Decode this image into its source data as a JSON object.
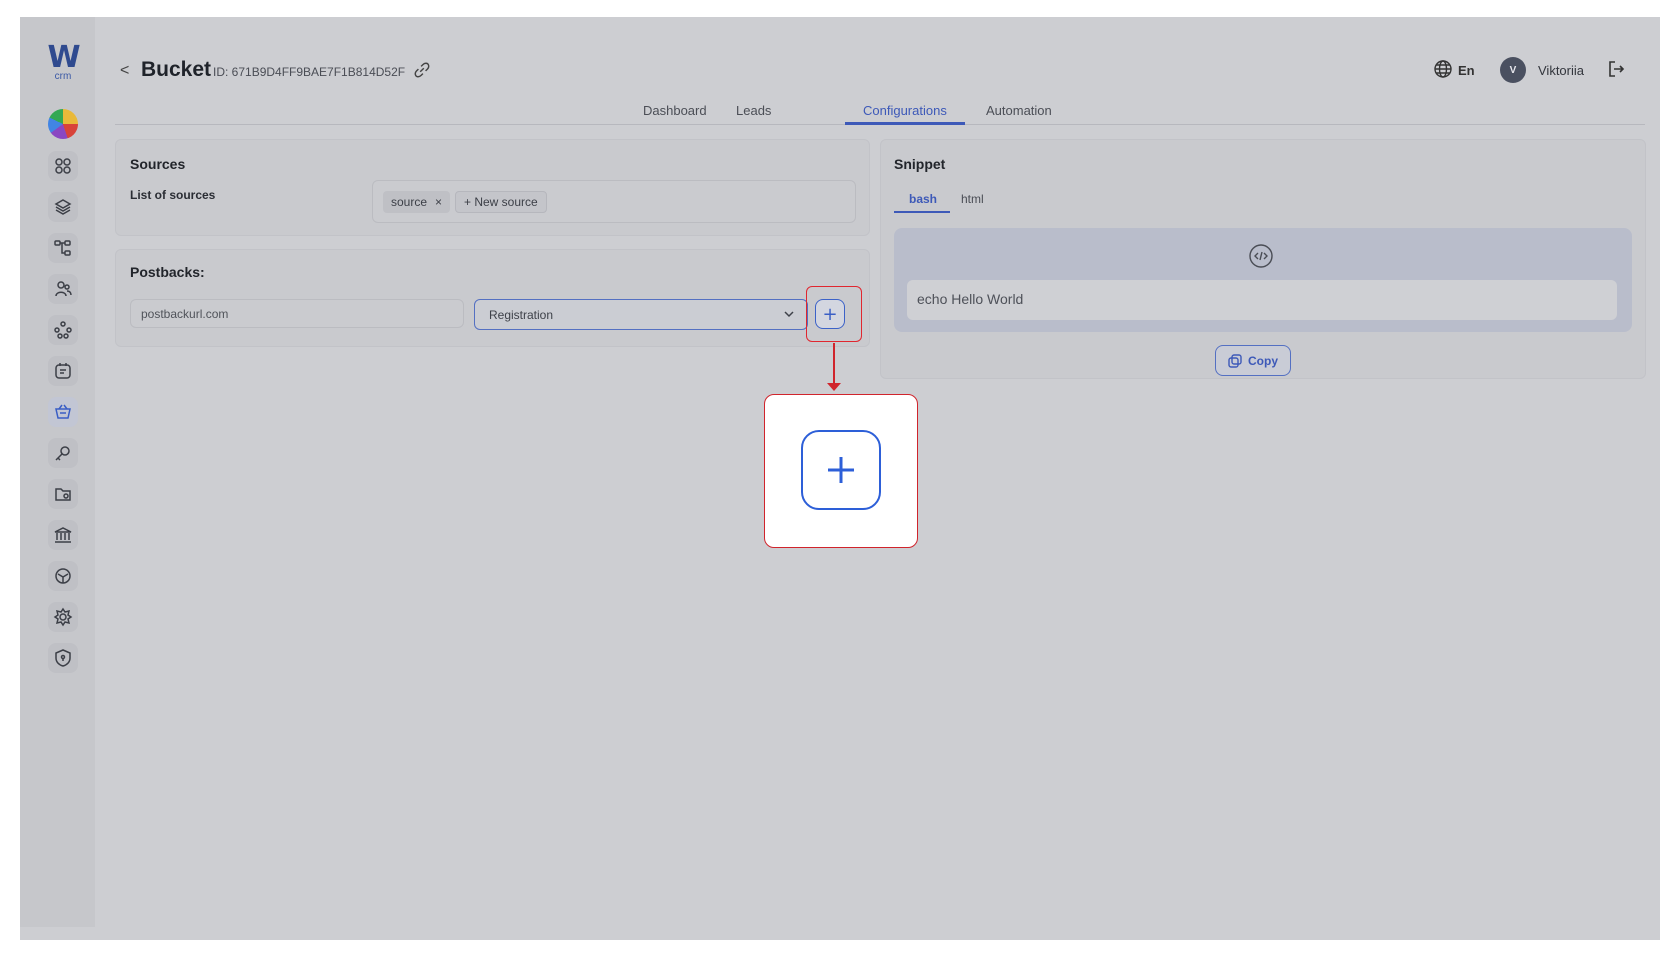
{
  "brand": {
    "logo_letter": "W",
    "logo_sub": "crm"
  },
  "header": {
    "back_glyph": "<",
    "title": "Bucket",
    "bucket_id": "ID: 671B9D4FF9BAE7F1B814D52F",
    "language": "En",
    "avatar_initial": "V",
    "username": "Viktoriia"
  },
  "tabs": [
    {
      "label": "Dashboard",
      "active": false
    },
    {
      "label": "Leads",
      "active": false
    },
    {
      "label": "Configurations",
      "active": true
    },
    {
      "label": "Automation",
      "active": false
    }
  ],
  "sidebar": {
    "items": [
      {
        "icon": "grid-icon"
      },
      {
        "icon": "layers-icon"
      },
      {
        "icon": "hierarchy-icon"
      },
      {
        "icon": "users-icon"
      },
      {
        "icon": "network-icon"
      },
      {
        "icon": "notes-icon"
      },
      {
        "icon": "basket-icon",
        "active": true
      },
      {
        "icon": "key-icon"
      },
      {
        "icon": "folder-icon"
      },
      {
        "icon": "bank-icon"
      },
      {
        "icon": "cube-icon"
      },
      {
        "icon": "gear-icon"
      },
      {
        "icon": "shield-icon"
      }
    ]
  },
  "sources": {
    "title": "Sources",
    "list_label": "List of sources",
    "chips": [
      {
        "label": "source",
        "remove_glyph": "×"
      }
    ],
    "new_source_label": "+ New source"
  },
  "postbacks": {
    "title": "Postbacks:",
    "url_value": "postbackurl.com",
    "event_value": "Registration",
    "add_glyph": "+"
  },
  "snippet": {
    "title": "Snippet",
    "tabs": [
      {
        "label": "bash",
        "active": true
      },
      {
        "label": "html",
        "active": false
      }
    ],
    "code": "echo Hello World",
    "copy_label": "Copy"
  },
  "colors": {
    "accent": "#3d59b8",
    "highlight": "#d0242c",
    "overlay": "#cdced2"
  }
}
